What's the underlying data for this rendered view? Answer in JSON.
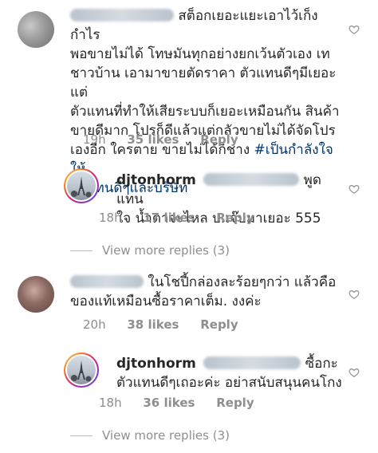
{
  "comments": [
    {
      "username": "",
      "text_lines": [
        "สต็อกเยอะแยะเอาไว้เก็งกำไร",
        "พอขายไม่ได้ โทษมันทุกอย่างยกเว้นตัวเอง เท",
        "ชาวบ้าน เอามาขายตัดราคา ตัวแทนดีๆมีเยอะแต่",
        "ตัวแทนที่ทำให้เสียระบบก็เยอะเหมือนกัน สินค้า",
        "ขายดีมาก โปรก็ดีแล้วแต่กลัวขายไม่ได้จัดโปร",
        "เองอีก ใครตาย ขายไม่ได้ก็ช่าง"
      ],
      "hashtag_inline": "#เป็นกำลังใจให้",
      "hashtag_line2": "ตัวแทนดีๆและบริษัท",
      "time": "19h",
      "likes": "35 likes",
      "reply": "Reply"
    },
    {
      "username": "djtonhorm",
      "text_tail": "พูดแทน",
      "text_line2": "ใจ น้ำตาจะไหล บ.เจ๊บมาเยอะ 555",
      "time": "18h",
      "likes": "17 likes",
      "reply": "Reply"
    },
    {
      "text_line1": "ในโชปี้กล่องละร้อยๆกว่า แล้วคือ",
      "text_line2": "ของแท้เหมือนซื้อราคาเต็ม. งงค่ะ",
      "time": "20h",
      "likes": "38 likes",
      "reply": "Reply"
    },
    {
      "username": "djtonhorm",
      "text_tail": "ซื้อกะ",
      "text_line2": "ตัวแทนดีๆเถอะค่ะ อย่าสนับสนุนคนโกง",
      "time": "18h",
      "likes": "36 likes",
      "reply": "Reply"
    }
  ],
  "view_more_1": "View more replies (3)",
  "view_more_2": "View more replies (3)",
  "icons": {
    "like": "heart-outline-icon"
  },
  "colors": {
    "text": "#262626",
    "muted": "#8e8e8e",
    "hashtag": "#003569"
  }
}
